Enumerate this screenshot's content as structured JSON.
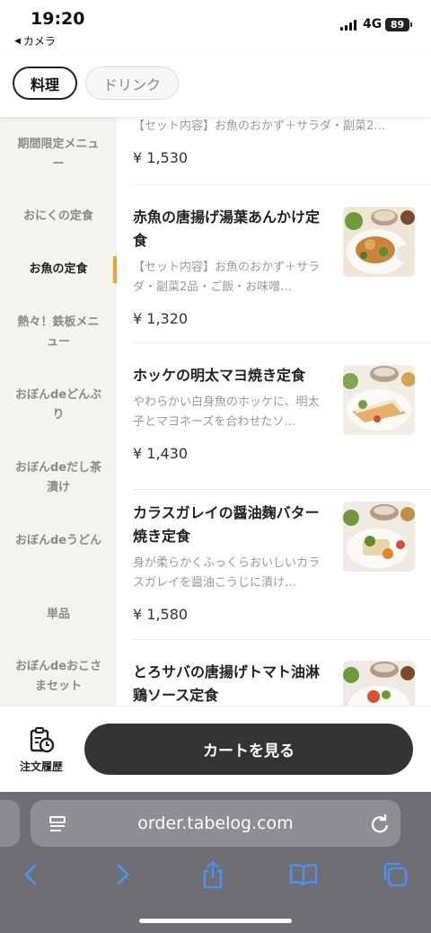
{
  "status_bar": {
    "time": "19:20",
    "back_app": "カメラ",
    "network": "4G",
    "battery": "89"
  },
  "tabs": [
    {
      "label": "料理",
      "active": true
    },
    {
      "label": "ドリンク",
      "active": false
    }
  ],
  "categories": [
    {
      "label": "期間限定メニュー",
      "active": false
    },
    {
      "label": "おにくの定食",
      "active": false
    },
    {
      "label": "お魚の定食",
      "active": true
    },
    {
      "label": "熱々！鉄板メニュー",
      "active": false
    },
    {
      "label": "おぼんdeどんぶり",
      "active": false
    },
    {
      "label": "おぼんdeだし茶漬け",
      "active": false
    },
    {
      "label": "おぼんdeうどん",
      "active": false
    },
    {
      "label": "単品",
      "active": false
    },
    {
      "label": "おぼんdeおこさまセット",
      "active": false
    }
  ],
  "menu_items": [
    {
      "name": "",
      "description": "【セット内容】お魚のおかず＋サラダ・副菜2…",
      "price": "¥ 1,530"
    },
    {
      "name": "赤魚の唐揚げ湯葉あんかけ定食",
      "description": "【セット内容】お魚のおかず＋サラダ・副菜2品・ご飯・お味噌…",
      "price": "¥ 1,320"
    },
    {
      "name": "ホッケの明太マヨ焼き定食",
      "description": "やわらかい白身魚のホッケに、明太子とマヨネーズを合わせたソ…",
      "price": "¥ 1,430"
    },
    {
      "name": "カラスガレイの醤油麹バター焼き定食",
      "description": "身が柔らかくふっくらおいしいカラスガレイを醤油こうじに漬け…",
      "price": "¥ 1,580"
    },
    {
      "name": "とろサバの唐揚げトマト油淋鶏ソース定食",
      "description": "",
      "price": ""
    }
  ],
  "action_bar": {
    "history_label": "注文履歴",
    "cart_label": "カートを見る"
  },
  "browser": {
    "url": "order.tabelog.com"
  },
  "colors": {
    "accent": "#f0a030",
    "button_dark": "#333333",
    "sidebar_bg": "#f5f3ee"
  }
}
